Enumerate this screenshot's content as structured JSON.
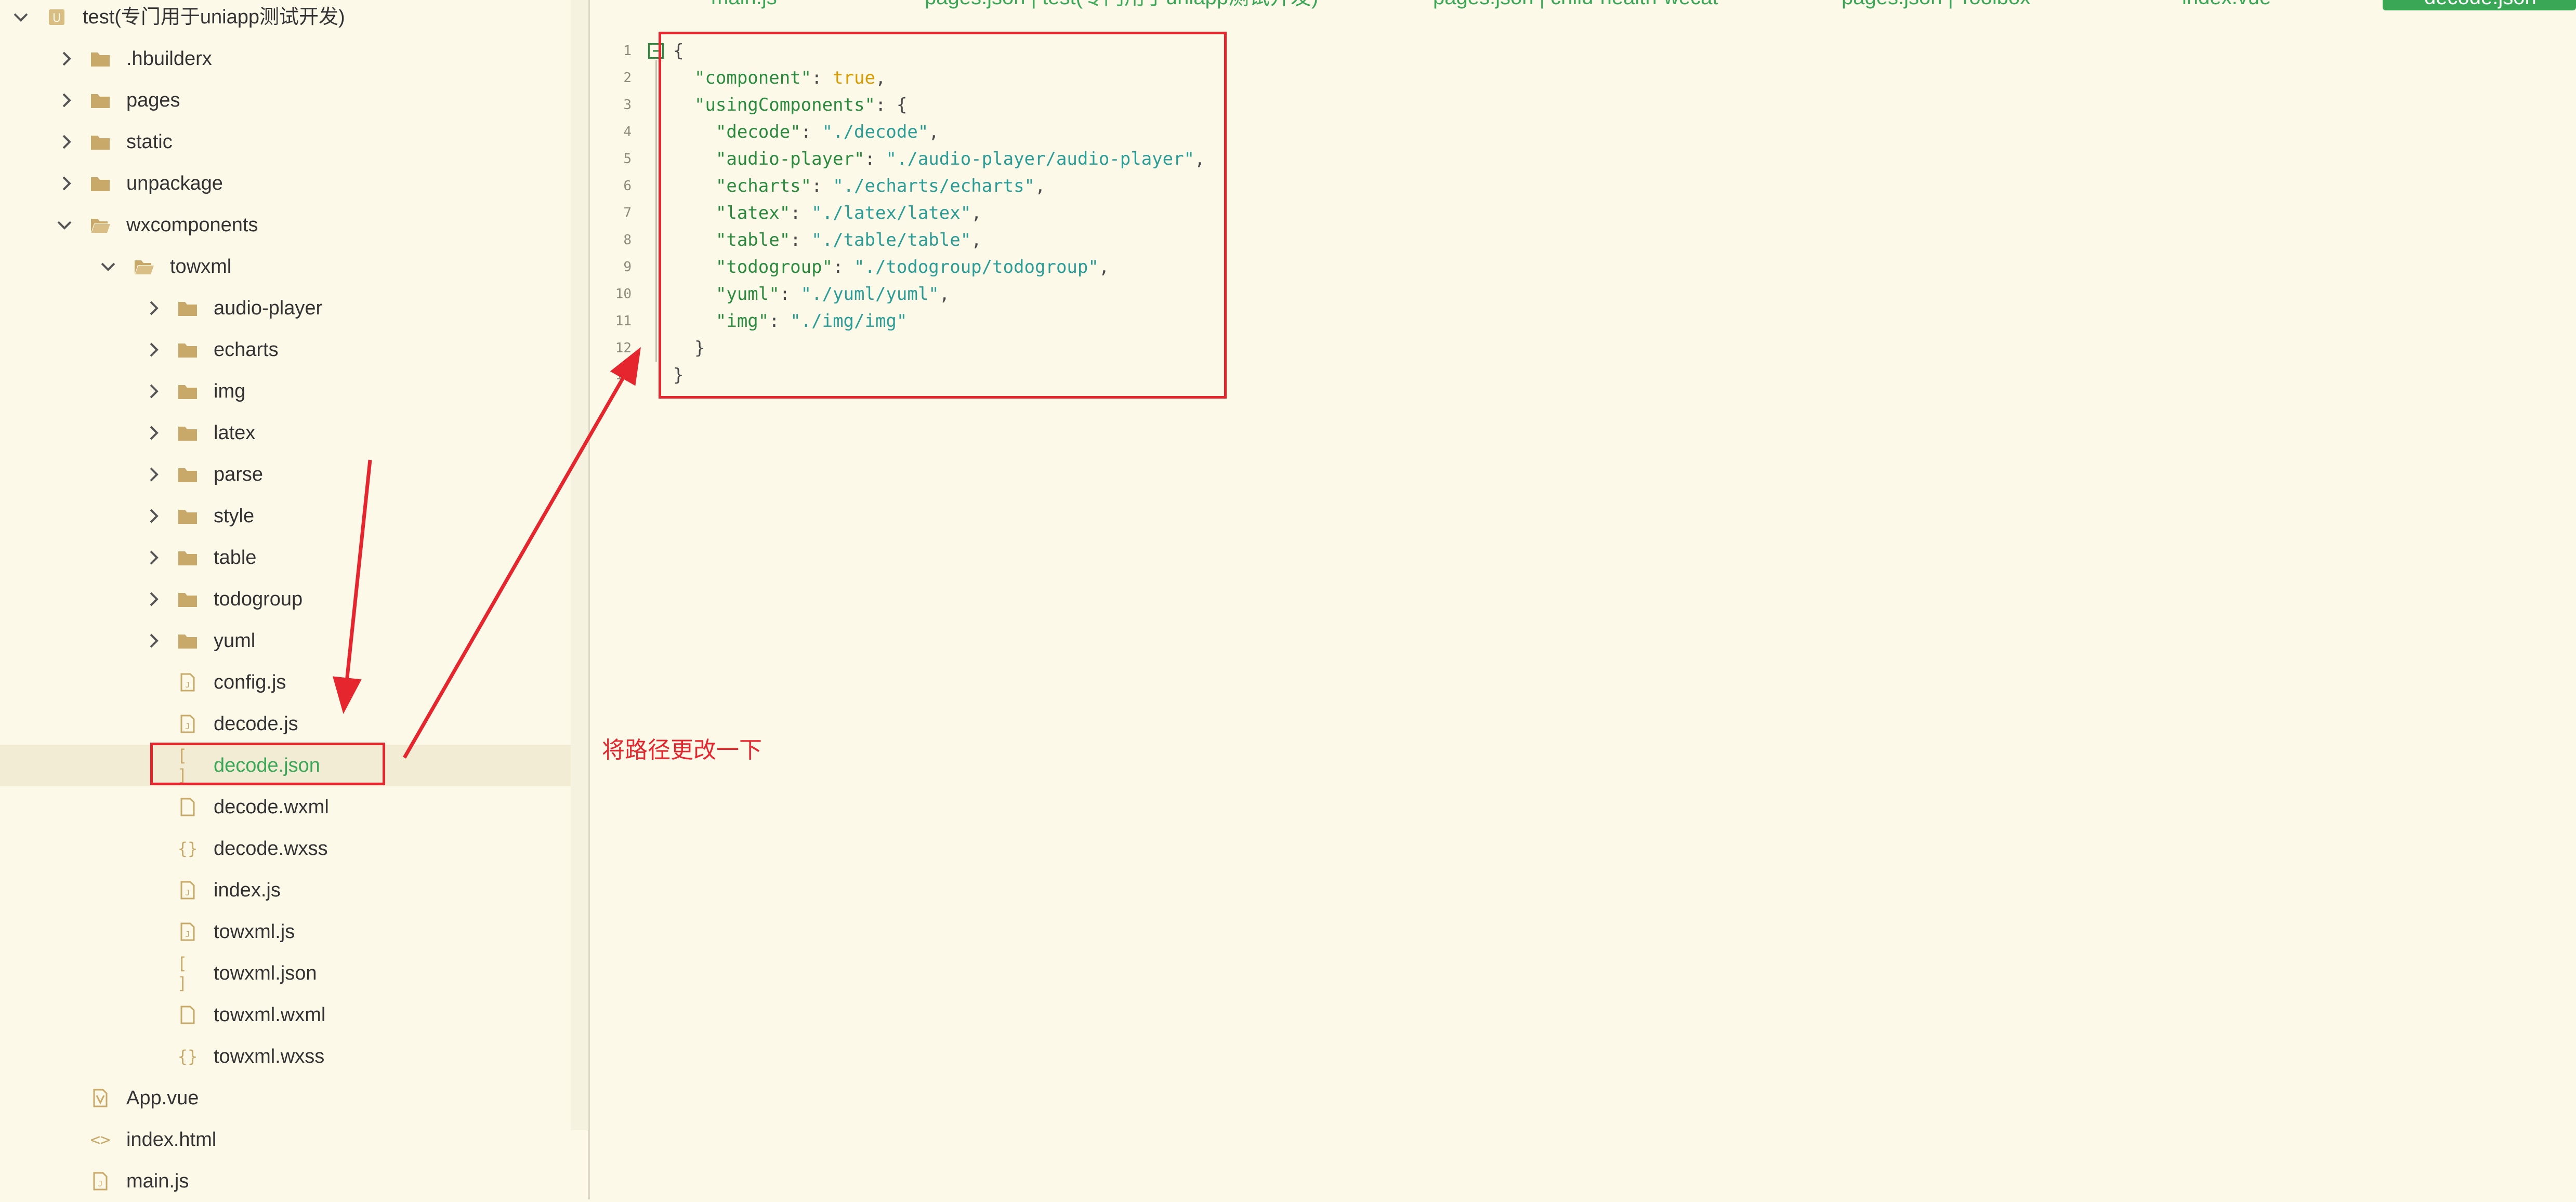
{
  "explorer": {
    "items": [
      {
        "label": "test(专门用于uniapp测试开发)",
        "depth": 0,
        "kind": "project",
        "expanded": true,
        "icon": "project-icon"
      },
      {
        "label": ".hbuilderx",
        "depth": 1,
        "kind": "folder",
        "expanded": false,
        "icon": "folder-icon"
      },
      {
        "label": "pages",
        "depth": 1,
        "kind": "folder",
        "expanded": false,
        "icon": "folder-icon"
      },
      {
        "label": "static",
        "depth": 1,
        "kind": "folder",
        "expanded": false,
        "icon": "folder-icon"
      },
      {
        "label": "unpackage",
        "depth": 1,
        "kind": "folder",
        "expanded": false,
        "icon": "folder-icon"
      },
      {
        "label": "wxcomponents",
        "depth": 1,
        "kind": "folder",
        "expanded": true,
        "icon": "folder-open-icon"
      },
      {
        "label": "towxml",
        "depth": 2,
        "kind": "folder",
        "expanded": true,
        "icon": "folder-open-icon"
      },
      {
        "label": "audio-player",
        "depth": 3,
        "kind": "folder",
        "expanded": false,
        "icon": "folder-icon"
      },
      {
        "label": "echarts",
        "depth": 3,
        "kind": "folder",
        "expanded": false,
        "icon": "folder-icon"
      },
      {
        "label": "img",
        "depth": 3,
        "kind": "folder",
        "expanded": false,
        "icon": "folder-icon"
      },
      {
        "label": "latex",
        "depth": 3,
        "kind": "folder",
        "expanded": false,
        "icon": "folder-icon"
      },
      {
        "label": "parse",
        "depth": 3,
        "kind": "folder",
        "expanded": false,
        "icon": "folder-icon"
      },
      {
        "label": "style",
        "depth": 3,
        "kind": "folder",
        "expanded": false,
        "icon": "folder-icon"
      },
      {
        "label": "table",
        "depth": 3,
        "kind": "folder",
        "expanded": false,
        "icon": "folder-icon"
      },
      {
        "label": "todogroup",
        "depth": 3,
        "kind": "folder",
        "expanded": false,
        "icon": "folder-icon"
      },
      {
        "label": "yuml",
        "depth": 3,
        "kind": "folder",
        "expanded": false,
        "icon": "folder-icon"
      },
      {
        "label": "config.js",
        "depth": 3,
        "kind": "file",
        "icon": "js-file-icon"
      },
      {
        "label": "decode.js",
        "depth": 3,
        "kind": "file",
        "icon": "js-file-icon"
      },
      {
        "label": "decode.json",
        "depth": 3,
        "kind": "file",
        "icon": "json-file-icon",
        "selected": true
      },
      {
        "label": "decode.wxml",
        "depth": 3,
        "kind": "file",
        "icon": "file-icon"
      },
      {
        "label": "decode.wxss",
        "depth": 3,
        "kind": "file",
        "icon": "css-file-icon"
      },
      {
        "label": "index.js",
        "depth": 3,
        "kind": "file",
        "icon": "js-file-icon"
      },
      {
        "label": "towxml.js",
        "depth": 3,
        "kind": "file",
        "icon": "js-file-icon"
      },
      {
        "label": "towxml.json",
        "depth": 3,
        "kind": "file",
        "icon": "json-file-icon"
      },
      {
        "label": "towxml.wxml",
        "depth": 3,
        "kind": "file",
        "icon": "file-icon"
      },
      {
        "label": "towxml.wxss",
        "depth": 3,
        "kind": "file",
        "icon": "css-file-icon"
      },
      {
        "label": "App.vue",
        "depth": 1,
        "kind": "file",
        "icon": "vue-file-icon"
      },
      {
        "label": "index.html",
        "depth": 1,
        "kind": "file",
        "icon": "html-file-icon"
      },
      {
        "label": "main.js",
        "depth": 1,
        "kind": "file",
        "icon": "js-file-icon"
      }
    ]
  },
  "tabs": [
    {
      "label": "main.js",
      "active": false
    },
    {
      "label": "pages.json | test(专门用于uniapp测试开发)",
      "active": false
    },
    {
      "label": "pages.json | child-health-wecat",
      "active": false
    },
    {
      "label": "pages.json | Toolbox",
      "active": false
    },
    {
      "label": "index.vue",
      "active": false
    },
    {
      "label": "decode.json",
      "active": true
    }
  ],
  "editor": {
    "lines": [
      [
        {
          "t": "{",
          "c": "punc"
        }
      ],
      [
        {
          "t": "  ",
          "c": "punc"
        },
        {
          "t": "\"component\"",
          "c": "key"
        },
        {
          "t": ": ",
          "c": "punc"
        },
        {
          "t": "true",
          "c": "bool"
        },
        {
          "t": ",",
          "c": "punc"
        }
      ],
      [
        {
          "t": "  ",
          "c": "punc"
        },
        {
          "t": "\"usingComponents\"",
          "c": "key"
        },
        {
          "t": ": {",
          "c": "punc"
        }
      ],
      [
        {
          "t": "    ",
          "c": "punc"
        },
        {
          "t": "\"decode\"",
          "c": "key"
        },
        {
          "t": ": ",
          "c": "punc"
        },
        {
          "t": "\"./decode\"",
          "c": "str"
        },
        {
          "t": ",",
          "c": "punc"
        }
      ],
      [
        {
          "t": "    ",
          "c": "punc"
        },
        {
          "t": "\"audio-player\"",
          "c": "key"
        },
        {
          "t": ": ",
          "c": "punc"
        },
        {
          "t": "\"./audio-player/audio-player\"",
          "c": "str"
        },
        {
          "t": ",",
          "c": "punc"
        }
      ],
      [
        {
          "t": "    ",
          "c": "punc"
        },
        {
          "t": "\"echarts\"",
          "c": "key"
        },
        {
          "t": ": ",
          "c": "punc"
        },
        {
          "t": "\"./echarts/echarts\"",
          "c": "str"
        },
        {
          "t": ",",
          "c": "punc"
        }
      ],
      [
        {
          "t": "    ",
          "c": "punc"
        },
        {
          "t": "\"latex\"",
          "c": "key"
        },
        {
          "t": ": ",
          "c": "punc"
        },
        {
          "t": "\"./latex/latex\"",
          "c": "str"
        },
        {
          "t": ",",
          "c": "punc"
        }
      ],
      [
        {
          "t": "    ",
          "c": "punc"
        },
        {
          "t": "\"table\"",
          "c": "key"
        },
        {
          "t": ": ",
          "c": "punc"
        },
        {
          "t": "\"./table/table\"",
          "c": "str"
        },
        {
          "t": ",",
          "c": "punc"
        }
      ],
      [
        {
          "t": "    ",
          "c": "punc"
        },
        {
          "t": "\"todogroup\"",
          "c": "key"
        },
        {
          "t": ": ",
          "c": "punc"
        },
        {
          "t": "\"./todogroup/todogroup\"",
          "c": "str"
        },
        {
          "t": ",",
          "c": "punc"
        }
      ],
      [
        {
          "t": "    ",
          "c": "punc"
        },
        {
          "t": "\"yuml\"",
          "c": "key"
        },
        {
          "t": ": ",
          "c": "punc"
        },
        {
          "t": "\"./yuml/yuml\"",
          "c": "str"
        },
        {
          "t": ",",
          "c": "punc"
        }
      ],
      [
        {
          "t": "    ",
          "c": "punc"
        },
        {
          "t": "\"img\"",
          "c": "key"
        },
        {
          "t": ": ",
          "c": "punc"
        },
        {
          "t": "\"./img/img\"",
          "c": "str"
        }
      ],
      [
        {
          "t": "  }",
          "c": "punc"
        }
      ],
      [
        {
          "t": "}",
          "c": "punc"
        }
      ]
    ]
  },
  "annotation": {
    "text": "将路径更改一下",
    "color": "#e5262e"
  },
  "colors": {
    "background": "#fdf9e8",
    "accent": "#3aa757",
    "annotation": "#e5262e",
    "folder": "#c9a96a",
    "json_key": "#2a8a3e",
    "json_string": "#2a9d97",
    "json_bool": "#d89b00"
  }
}
